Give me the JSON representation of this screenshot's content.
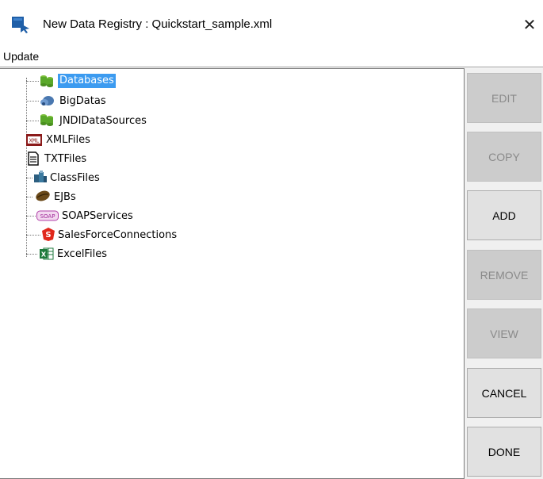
{
  "window": {
    "title": "New Data Registry : Quickstart_sample.xml",
    "close_label": "✕"
  },
  "menu": {
    "items": [
      "Update"
    ]
  },
  "tree": {
    "nodes": [
      {
        "label": "Databases",
        "icon": "database-icon",
        "selected": true
      },
      {
        "label": "BigDatas",
        "icon": "bigdata-icon",
        "selected": false
      },
      {
        "label": "JNDIDataSources",
        "icon": "jndi-datasource-icon",
        "selected": false
      },
      {
        "label": "XMLFiles",
        "icon": "xml-file-icon",
        "selected": false
      },
      {
        "label": "TXTFiles",
        "icon": "txt-file-icon",
        "selected": false
      },
      {
        "label": "ClassFiles",
        "icon": "class-file-icon",
        "selected": false
      },
      {
        "label": "EJBs",
        "icon": "ejb-icon",
        "selected": false
      },
      {
        "label": "SOAPServices",
        "icon": "soap-service-icon",
        "selected": false
      },
      {
        "label": "SalesForceConnections",
        "icon": "salesforce-icon",
        "selected": false
      },
      {
        "label": "ExcelFiles",
        "icon": "excel-file-icon",
        "selected": false
      }
    ]
  },
  "buttons": [
    {
      "label": "EDIT",
      "enabled": false
    },
    {
      "label": "COPY",
      "enabled": false
    },
    {
      "label": "ADD",
      "enabled": true
    },
    {
      "label": "REMOVE",
      "enabled": false
    },
    {
      "label": "VIEW",
      "enabled": false
    },
    {
      "label": "CANCEL",
      "enabled": true
    },
    {
      "label": "DONE",
      "enabled": true
    }
  ],
  "colors": {
    "selection": "#3c9bf0",
    "app_icon": "#1f5fa8"
  }
}
